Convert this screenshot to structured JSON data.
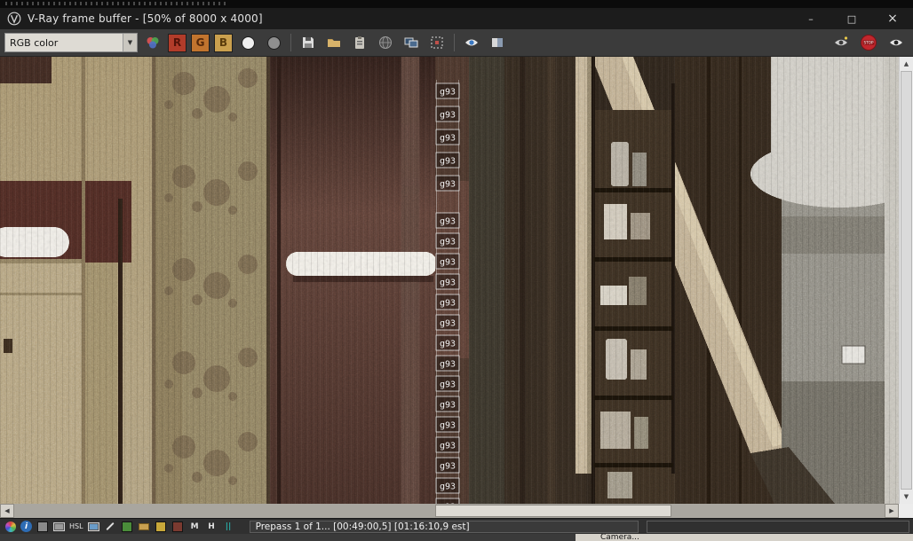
{
  "window": {
    "title": "V-Ray frame buffer - [50% of 8000 x 4000]",
    "controls": {
      "minimize": "–",
      "maximize": "□",
      "close": "×"
    }
  },
  "toolbar": {
    "channel_dropdown": {
      "value": "RGB color",
      "arrow": "▼"
    },
    "channels": {
      "red": "R",
      "green": "G",
      "blue": "B"
    },
    "stop_label": "STOP"
  },
  "render": {
    "bucket_label": "g93"
  },
  "scrollbars": {
    "up": "▲",
    "down": "▼",
    "left": "◀",
    "right": "▶"
  },
  "statusbar": {
    "text": "Prepass 1 of 1... [00:49:00,5] [01:16:10,9 est]",
    "glyphs": {
      "info": "i",
      "hsl": "HSL",
      "letter_m": "M",
      "letter_h": "H",
      "pause": "||"
    }
  },
  "bottom_strip": {
    "label": "Camera..."
  },
  "colors": {
    "stop_red": "#c1272d",
    "red_channel": "#b23c2a",
    "green_channel": "#c1742e",
    "blue_channel": "#caa04e",
    "titlebar_bg": "#1c1c1c",
    "toolbar_bg": "#3b3b3b",
    "statusbar_bg": "#303030"
  }
}
